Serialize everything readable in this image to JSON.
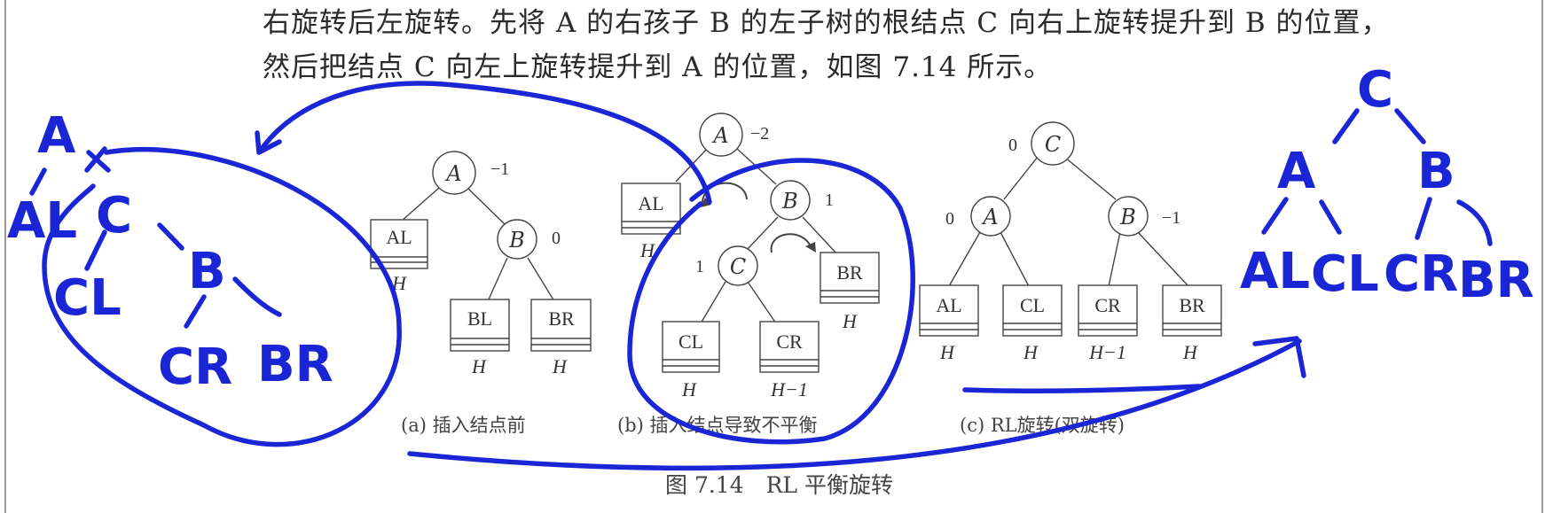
{
  "text": {
    "line1": "右旋转后左旋转。先将 A 的右孩子 B 的左子树的根结点 C 向右上旋转提升到 B 的位置，",
    "line2": "然后把结点 C 向左上旋转提升到 A 的位置，如图 7.14 所示。"
  },
  "figure": {
    "caption": "图 7.14　RL 平衡旋转",
    "subfigures": {
      "a": {
        "caption": "(a) 插入结点前",
        "nodes": {
          "A": "A",
          "B": "B"
        },
        "balances": {
          "A": "−1",
          "B": "0"
        },
        "boxes": {
          "AL": "AL",
          "BL": "BL",
          "BR": "BR"
        },
        "heights": {
          "AL": "H",
          "BL": "H",
          "BR": "H"
        }
      },
      "b": {
        "caption": "(b) 插入结点导致不平衡",
        "nodes": {
          "A": "A",
          "B": "B",
          "C": "C"
        },
        "balances": {
          "A": "−2",
          "B": "1",
          "C": "1"
        },
        "boxes": {
          "AL": "AL",
          "BR": "BR",
          "CL": "CL",
          "CR": "CR"
        },
        "heights": {
          "AL": "H",
          "BR": "H",
          "CL": "H",
          "CR": "H−1"
        }
      },
      "c": {
        "caption": "(c) RL旋转(双旋转)",
        "nodes": {
          "C": "C",
          "A": "A",
          "B": "B"
        },
        "balances": {
          "C": "0",
          "A": "0",
          "B": "−1"
        },
        "boxes": {
          "AL": "AL",
          "CL": "CL",
          "CR": "CR",
          "BR": "BR"
        },
        "heights": {
          "AL": "H",
          "CL": "H",
          "CR": "H−1",
          "BR": "H"
        }
      }
    }
  },
  "handwriting": {
    "left_tree": {
      "A": "A",
      "AL": "AL",
      "C": "C",
      "CL": "CL",
      "B": "B",
      "CR": "CR",
      "BR": "BR"
    },
    "right_tree": {
      "C": "C",
      "A": "A",
      "B": "B",
      "AL": "AL",
      "CL": "CL",
      "CR": "CR",
      "BR": "BR"
    },
    "ink_color": "#1a26d6"
  }
}
